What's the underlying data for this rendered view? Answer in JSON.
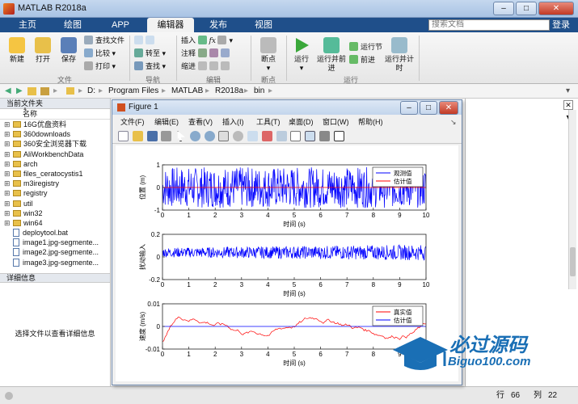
{
  "window": {
    "title": "MATLAB R2018a"
  },
  "tabs": [
    {
      "label": "主页"
    },
    {
      "label": "绘图"
    },
    {
      "label": "APP"
    },
    {
      "label": "编辑器"
    },
    {
      "label": "发布"
    },
    {
      "label": "视图"
    }
  ],
  "search": {
    "placeholder": "搜索文档"
  },
  "login_label": "登录",
  "ribbon": {
    "new": "新建",
    "open": "打开",
    "save": "保存",
    "find_files": "查找文件",
    "compare": "比较",
    "print": "打印",
    "goto": "转至",
    "find": "查找",
    "insert": "插入",
    "comment": "注释",
    "indent": "缩进",
    "breakpoint": "断点",
    "run": "运行",
    "run_advance": "运行并前进",
    "run_section": "运行节",
    "advance": "前进",
    "run_time": "运行并计时",
    "groups": {
      "file": "文件",
      "nav": "导航",
      "edit": "编辑",
      "breakpoints": "断点",
      "run": "运行"
    }
  },
  "address": {
    "segments": [
      "D:",
      "Program Files",
      "MATLAB",
      "R2018a",
      "bin"
    ]
  },
  "current_folder": {
    "title": "当前文件夹",
    "column_name": "名称",
    "sort_indicator": "▲",
    "items": [
      {
        "name": "16G优盘资料",
        "type": "folder"
      },
      {
        "name": "360downloads",
        "type": "folder"
      },
      {
        "name": "360安全浏览器下载",
        "type": "folder"
      },
      {
        "name": "AliWorkbenchData",
        "type": "folder"
      },
      {
        "name": "arch",
        "type": "folder"
      },
      {
        "name": "files_ceratocystis1",
        "type": "folder"
      },
      {
        "name": "m3iregistry",
        "type": "folder"
      },
      {
        "name": "registry",
        "type": "folder"
      },
      {
        "name": "util",
        "type": "folder"
      },
      {
        "name": "win32",
        "type": "folder"
      },
      {
        "name": "win64",
        "type": "folder"
      },
      {
        "name": "deploytool.bat",
        "type": "file"
      },
      {
        "name": "image1.jpg-segmente...",
        "type": "file"
      },
      {
        "name": "image2.jpg-segmente...",
        "type": "file"
      },
      {
        "name": "image3.jpg-segmente...",
        "type": "file"
      }
    ]
  },
  "details": {
    "title": "详细信息",
    "message": "选择文件以查看详细信息"
  },
  "status": {
    "row_label": "行",
    "row": "66",
    "col_label": "列",
    "col": "22"
  },
  "figure": {
    "title": "Figure 1",
    "menu": [
      "文件(F)",
      "编辑(E)",
      "查看(V)",
      "插入(I)",
      "工具(T)",
      "桌面(D)",
      "窗口(W)",
      "帮助(H)"
    ]
  },
  "chart_data": [
    {
      "type": "line",
      "ylabel": "位置 (m)",
      "xlabel": "时间 (s)",
      "xlim": [
        0,
        10
      ],
      "ylim": [
        -1,
        1
      ],
      "xticks": [
        0,
        1,
        2,
        3,
        4,
        5,
        6,
        7,
        8,
        9,
        10
      ],
      "yticks": [
        -1,
        0,
        1
      ],
      "series": [
        {
          "name": "观测值",
          "color": "#0000ff",
          "pattern": "noise",
          "amplitude": 0.9,
          "offset": 0
        },
        {
          "name": "估计值",
          "color": "#ff0000",
          "pattern": "flat",
          "amplitude": 0.02,
          "offset": 0
        }
      ],
      "legend": "top-right"
    },
    {
      "type": "line",
      "ylabel": "扰动输入",
      "xlabel": "时间 (s)",
      "xlim": [
        0,
        10
      ],
      "ylim": [
        -0.2,
        0.2
      ],
      "xticks": [
        0,
        1,
        2,
        3,
        4,
        5,
        6,
        7,
        8,
        9,
        10
      ],
      "yticks": [
        -0.2,
        0,
        0.2
      ],
      "series": [
        {
          "color": "#0000ff",
          "pattern": "noise",
          "amplitude": 0.07,
          "offset": 0.04
        }
      ]
    },
    {
      "type": "line",
      "ylabel": "速度 (m/s)",
      "xlabel": "时间 (s)",
      "xlim": [
        0,
        10
      ],
      "ylim": [
        -0.01,
        0.01
      ],
      "xticks": [
        0,
        1,
        2,
        3,
        4,
        5,
        6,
        7,
        8,
        9,
        10
      ],
      "yticks": [
        -0.01,
        0,
        0.01
      ],
      "series": [
        {
          "name": "真实值",
          "color": "#ff0000",
          "pattern": "wander",
          "amplitude": 0.006,
          "offset": 0.002
        },
        {
          "name": "估计值",
          "color": "#0000ff",
          "pattern": "flat",
          "amplitude": 0,
          "offset": 0
        }
      ],
      "legend": "top-right"
    }
  ],
  "watermark": {
    "brand": "必过源码",
    "url": "Biguo100.com"
  }
}
